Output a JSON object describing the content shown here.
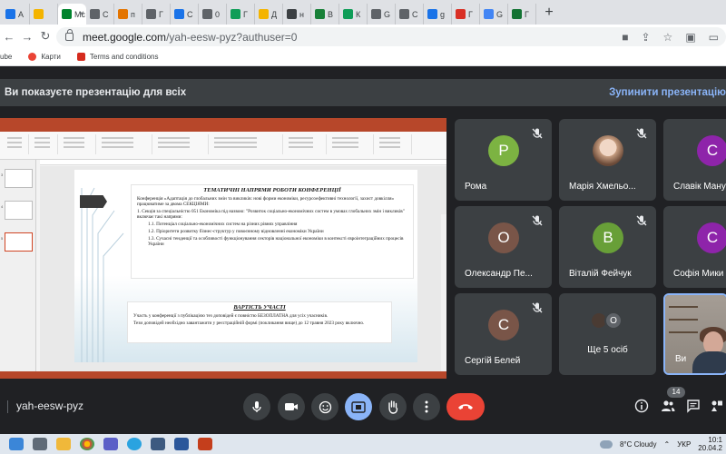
{
  "browser": {
    "tabs": [
      {
        "label": "A",
        "color": "#1a73e8"
      },
      {
        "label": "",
        "color": "#f4b400"
      },
      {
        "label": "Mc",
        "color": "#00832d",
        "active": true
      },
      {
        "label": "C",
        "color": "#5f6368"
      },
      {
        "label": "п",
        "color": "#e37400"
      },
      {
        "label": "Г",
        "color": "#5f6368"
      },
      {
        "label": "С",
        "color": "#1a73e8"
      },
      {
        "label": "0",
        "color": "#5f6368"
      },
      {
        "label": "Г",
        "color": "#0f9d58"
      },
      {
        "label": "Д",
        "color": "#f4b400"
      },
      {
        "label": "н",
        "color": "#3c4043"
      },
      {
        "label": "В",
        "color": "#188038"
      },
      {
        "label": "К",
        "color": "#0f9d58"
      },
      {
        "label": "G",
        "color": "#5f6368"
      },
      {
        "label": "C",
        "color": "#5f6368"
      },
      {
        "label": "g",
        "color": "#1a73e8"
      },
      {
        "label": "Г",
        "color": "#d93025"
      },
      {
        "label": "G",
        "color": "#4285f4"
      },
      {
        "label": "Г",
        "color": "#137333"
      }
    ],
    "url_host": "meet.google.com",
    "url_path": "/yah-eesw-pyz?authuser=0",
    "bookmarks": [
      "ube",
      "Карти",
      "Terms and conditions"
    ]
  },
  "meet": {
    "present_banner": "Ви показуєте презентацію для всіх",
    "stop_present": "Зупинити презентацію",
    "participants": [
      {
        "name": "Рома",
        "initial": "Р",
        "color": "#7cb342",
        "muted": true
      },
      {
        "name": "Марія Хмельо...",
        "initial": "",
        "color": "#e0c7b8",
        "muted": true,
        "photo": true
      },
      {
        "name": "Славік Мануш",
        "initial": "С",
        "color": "#8e24aa",
        "muted": true
      },
      {
        "name": "Олександр Пе...",
        "initial": "О",
        "color": "#795548",
        "muted": true
      },
      {
        "name": "Віталій Фейчук",
        "initial": "В",
        "color": "#689f38",
        "muted": true
      },
      {
        "name": "Софія Мики",
        "initial": "С",
        "color": "#8e24aa",
        "muted": true
      },
      {
        "name": "Сергій Белей",
        "initial": "С",
        "color": "#795548",
        "muted": true
      },
      {
        "name": "Ще 5 осіб",
        "initial": "О",
        "color": "#5f6368",
        "muted": false,
        "more": true
      },
      {
        "name": "Ви",
        "initial": "",
        "color": "#8ab4f8",
        "muted": false,
        "self": true
      }
    ],
    "meeting_code": "yah-eesw-pyz",
    "participant_count": "14"
  },
  "slide": {
    "heading": "ТЕМАТИЧНІ НАПРЯМИ РОБОТИ КОНФЕРЕНЦІЇ",
    "intro": "Конференція «Адаптація до глобальних змін та викликів: нові форми економіки, ресурсоефективні технології, захист довкілля» працюватиме за двома СЕКЦІЯМИ:",
    "section1": "1. Секція за спеціальністю 051 Економіка під назвою: \"Розвиток соціально-економічних систем в умовах глобальних змін і викликів\" включає такі напрями:",
    "item1": "1.1. Потенціал соціально-економічних систем на різних рівнях управління",
    "item2": "1.2. Пріоритети розвитку бізнес-структур у повоєнному відновленні економіки України",
    "item3": "1.3. Сучасні тенденції та особливості функціонування секторів національної економіки в контексті євроінтеграційних процесів України",
    "cost_heading": "ВАРТІСТЬ УЧАСТІ",
    "cost_text": "Участь у конференції з публікацією тез доповідей є повністю БЕЗОПЛАТНА для усіх учасників.",
    "deadline_text": "Тези доповідей необхідно завантажити у реєстраційній формі (покликання вище) до 12 травня 2023 року включно."
  },
  "taskbar": {
    "weather": "8°C Cloudy",
    "language": "УКР",
    "time": "10:1",
    "date": "20.04.2"
  }
}
